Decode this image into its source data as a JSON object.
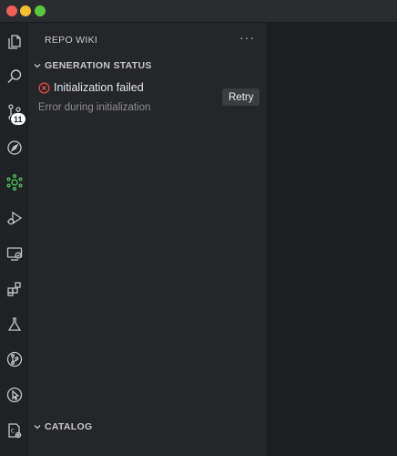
{
  "window": {
    "controls": [
      "close",
      "minimize",
      "zoom"
    ],
    "colors": {
      "close": "#ee5f57",
      "minimize": "#f5bd30",
      "zoom": "#5bc73e"
    }
  },
  "activity_bar": {
    "items": [
      {
        "icon": "explorer-icon"
      },
      {
        "icon": "search-icon"
      },
      {
        "icon": "source-control-icon",
        "badge": "11"
      },
      {
        "icon": "compass-icon"
      },
      {
        "icon": "repo-wiki-icon",
        "active": true,
        "color": "#4ec45c"
      },
      {
        "icon": "run-debug-icon"
      },
      {
        "icon": "remote-explorer-icon"
      },
      {
        "icon": "extensions-icon"
      },
      {
        "icon": "testing-icon"
      },
      {
        "icon": "git-graph-icon"
      },
      {
        "icon": "pointer-icon"
      },
      {
        "icon": "settings-file-icon"
      }
    ]
  },
  "sidebar": {
    "title": "REPO WIKI",
    "more": "···",
    "sections": {
      "generation_status": {
        "title": "GENERATION STATUS",
        "status": "Initialization failed",
        "status_color": "#f14c4c",
        "retry_label": "Retry",
        "detail": "Error during initialization"
      },
      "catalog": {
        "title": "CATALOG"
      }
    }
  }
}
